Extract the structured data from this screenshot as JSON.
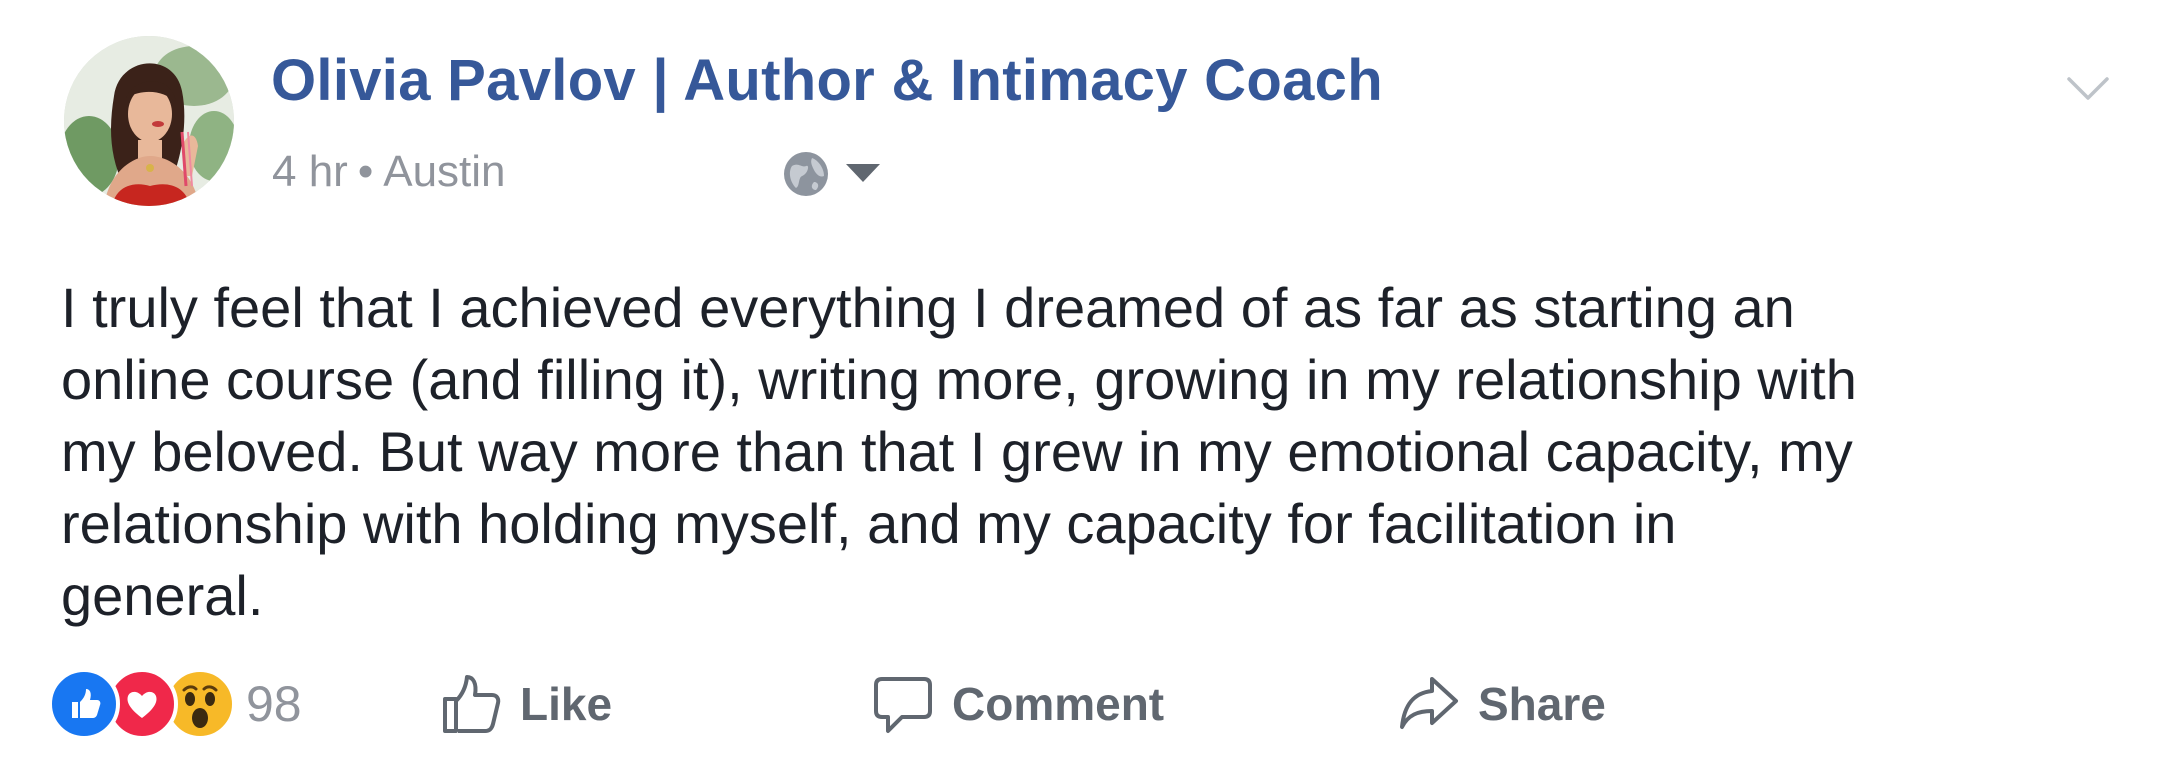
{
  "post": {
    "author": "Olivia Pavlov | Author & Intimacy Coach",
    "time": "4 hr",
    "separator": "•",
    "location": "Austin",
    "privacy_icon": "globe-icon",
    "menu_icon": "chevron-down-icon",
    "text_lines": [
      "I truly feel that I achieved everything I dreamed of as far as starting an",
      "online course (and filling it), writing more, growing in my relationship with",
      "my beloved. But way more than that I grew in my emotional capacity, my",
      "relationship with holding myself, and my capacity for facilitation in",
      "general."
    ]
  },
  "reactions": {
    "items": [
      "like",
      "love",
      "wow"
    ],
    "count": "98"
  },
  "actions": {
    "like": "Like",
    "comment": "Comment",
    "share": "Share"
  },
  "colors": {
    "author": "#365899",
    "meta": "#90949c",
    "text": "#1d2129",
    "action": "#606770",
    "like_reaction": "#1877f2",
    "love_reaction": "#f0284a",
    "wow_reaction": "#f7b928"
  }
}
